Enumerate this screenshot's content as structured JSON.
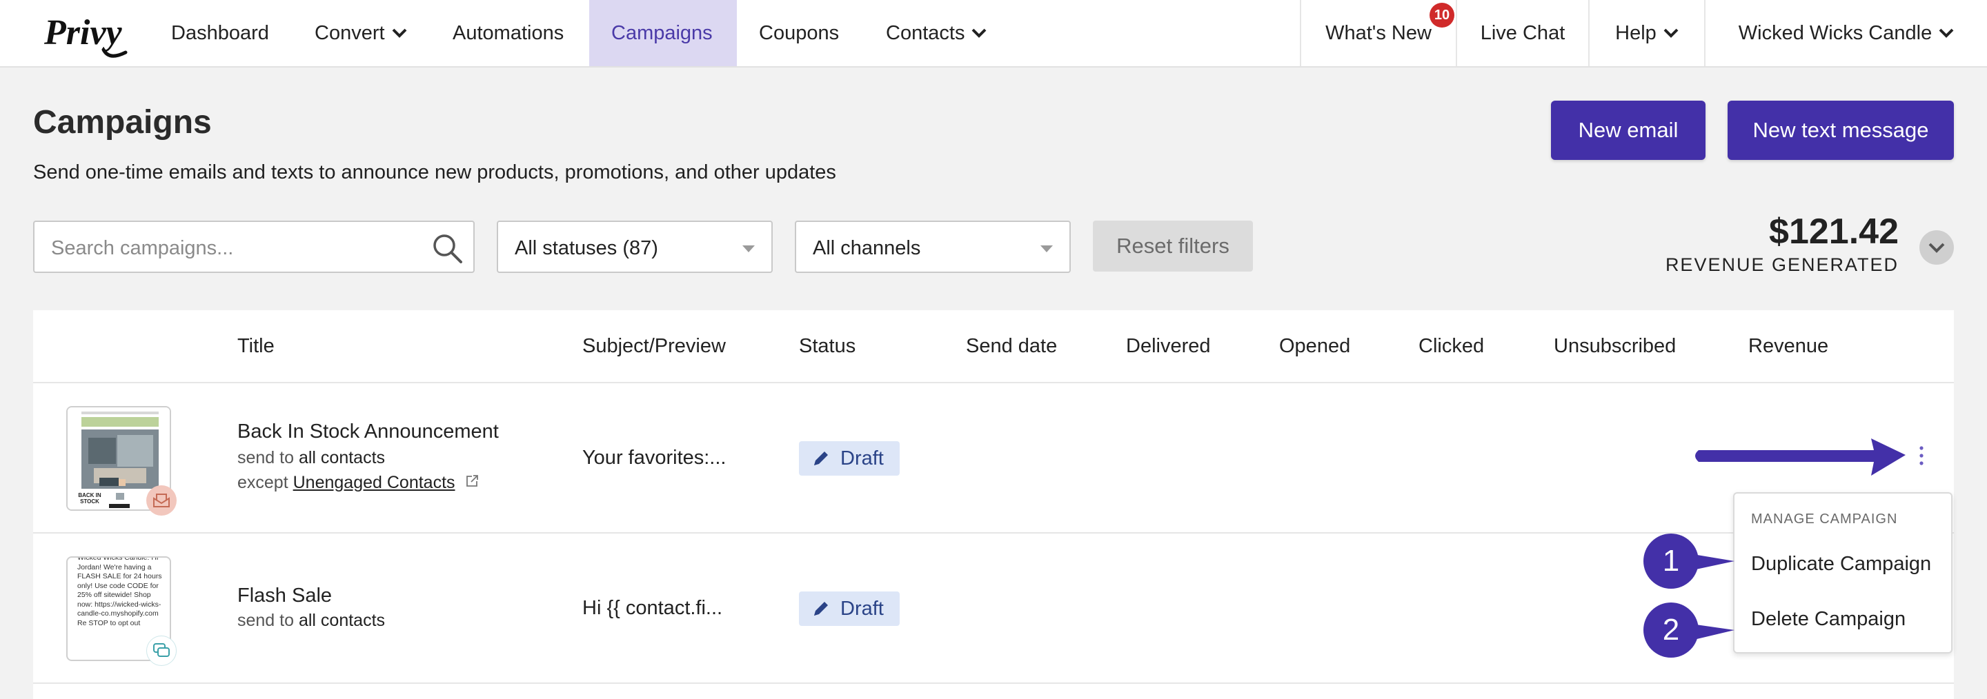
{
  "nav": {
    "logo_text": "Privy",
    "items": [
      {
        "label": "Dashboard"
      },
      {
        "label": "Convert"
      },
      {
        "label": "Automations"
      },
      {
        "label": "Campaigns"
      },
      {
        "label": "Coupons"
      },
      {
        "label": "Contacts"
      }
    ],
    "whats_new": "What's New",
    "whats_new_badge": "10",
    "live_chat": "Live Chat",
    "help": "Help",
    "store": "Wicked Wicks Candle"
  },
  "header": {
    "title": "Campaigns",
    "subtitle": "Send one-time emails and texts to announce new products, promotions, and other updates",
    "new_email": "New email",
    "new_text": "New text message"
  },
  "filters": {
    "search_placeholder": "Search campaigns...",
    "status": "All statuses (87)",
    "channels": "All channels",
    "reset": "Reset filters"
  },
  "revenue": {
    "amount": "$121.42",
    "label": "REVENUE GENERATED"
  },
  "table": {
    "columns": [
      "Title",
      "Subject/Preview",
      "Status",
      "Send date",
      "Delivered",
      "Opened",
      "Clicked",
      "Unsubscribed",
      "Revenue"
    ],
    "rows": [
      {
        "title": "Back In Stock Announcement",
        "send_prefix": "send to",
        "send_target": "all contacts",
        "except_prefix": "except",
        "except_target": "Unengaged Contacts",
        "subject": "Your favorites:...",
        "status": "Draft",
        "thumb_text": "BACK IN STOCK"
      },
      {
        "title": "Flash Sale",
        "send_prefix": "send to",
        "send_target": "all contacts",
        "subject": "Hi {{ contact.fi...",
        "status": "Draft",
        "thumb_text": "Wicked Wicks Candle: Hi Jordan! We're having a FLASH SALE for 24 hours only! Use code CODE for 25% off sitewide! Shop now: https://wicked-wicks-candle-co.myshopify.com Re STOP to opt out"
      }
    ]
  },
  "menu": {
    "header": "MANAGE CAMPAIGN",
    "duplicate": "Duplicate Campaign",
    "delete": "Delete Campaign"
  },
  "annotations": {
    "step1": "1",
    "step2": "2"
  },
  "colors": {
    "brand": "#4330a8",
    "nav_active_bg": "#dcd8f2",
    "draft_bg": "#dde6f7",
    "badge": "#d02a2a"
  }
}
